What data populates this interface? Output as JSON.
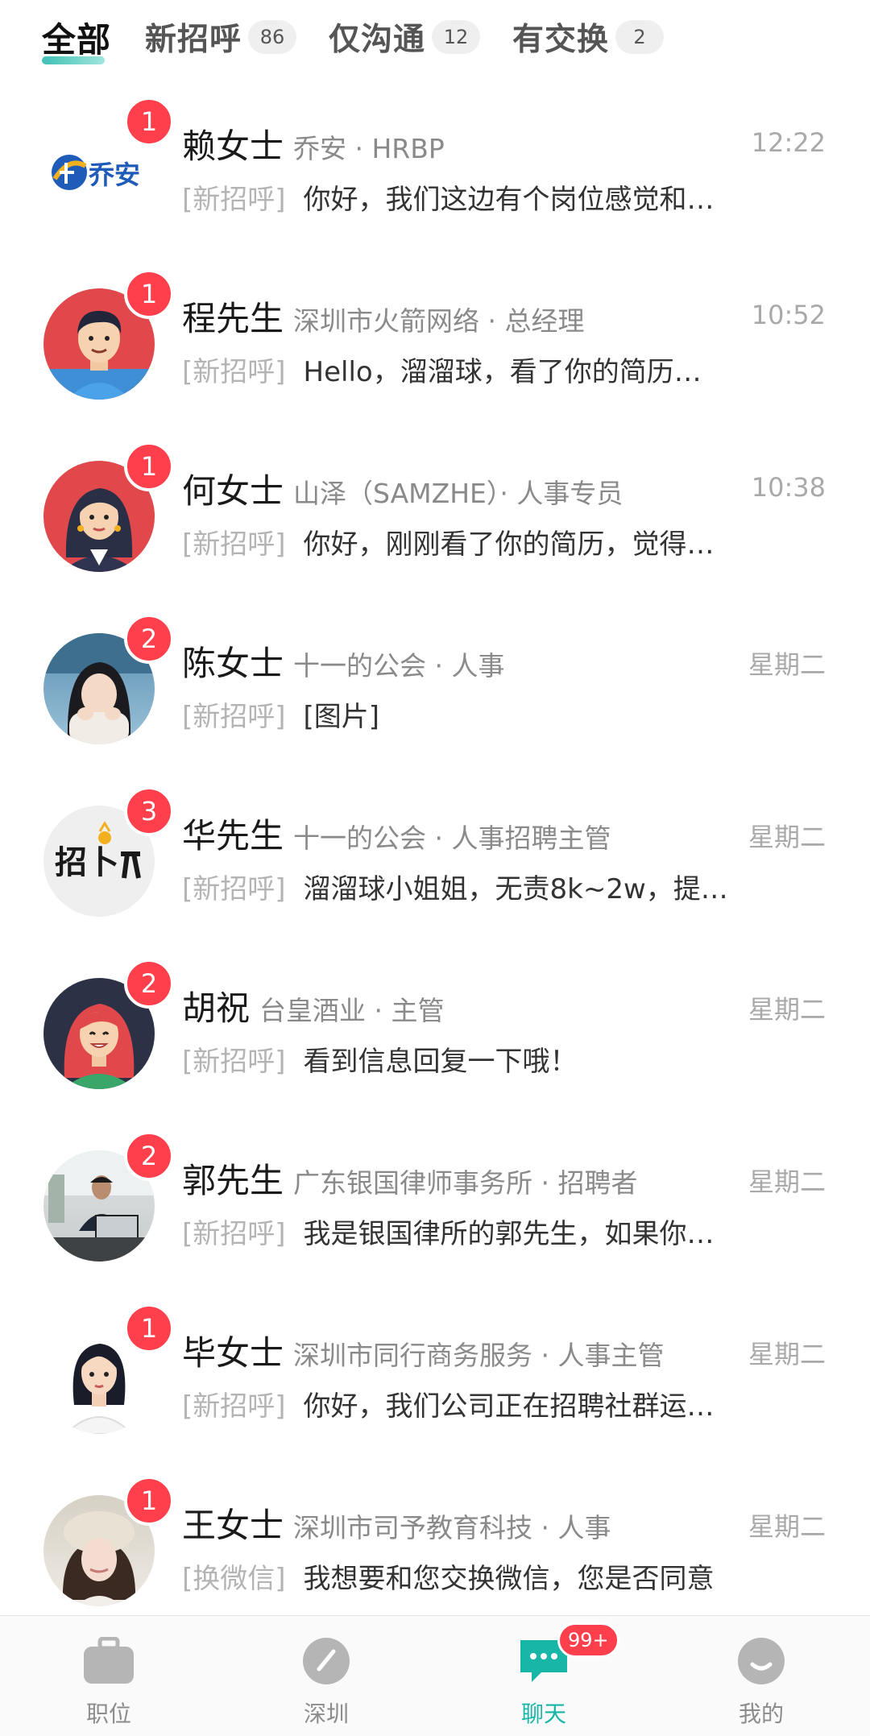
{
  "tabs": [
    {
      "label": "全部",
      "count": ""
    },
    {
      "label": "新招呼",
      "count": "86"
    },
    {
      "label": "仅沟通",
      "count": "12"
    },
    {
      "label": "有交换",
      "count": "2"
    }
  ],
  "chats": [
    {
      "name": "赖女士",
      "company": "乔安 · HRBP",
      "time": "12:22",
      "tag": "[新招呼]",
      "message": "你好，我们这边有个岗位感觉和…",
      "unread": "1",
      "avatar_icon": "qiaoan-logo",
      "avatar_text": "乔安"
    },
    {
      "name": "程先生",
      "company": "深圳市火箭网络 · 总经理",
      "time": "10:52",
      "tag": "[新招呼]",
      "message": "Hello，溜溜球，看了你的简历…",
      "unread": "1",
      "avatar_icon": "male-cartoon-avatar"
    },
    {
      "name": "何女士",
      "company": "山泽（SAMZHE）· 人事专员",
      "time": "10:38",
      "tag": "[新招呼]",
      "message": "你好，刚刚看了你的简历，觉得…",
      "unread": "1",
      "avatar_icon": "female-cartoon-avatar"
    },
    {
      "name": "陈女士",
      "company": "十一的公会 · 人事",
      "time": "星期二",
      "tag": "[新招呼]",
      "message": "[图片]",
      "unread": "2",
      "avatar_icon": "photo-avatar"
    },
    {
      "name": "华先生",
      "company": "十一的公会 · 人事招聘主管",
      "time": "星期二",
      "tag": "[新招呼]",
      "message": "溜溜球小姐姐，无责8k~2w，提…",
      "unread": "3",
      "avatar_icon": "zhaobobo-logo",
      "avatar_text": "招卜"
    },
    {
      "name": "胡祝",
      "company": "台皇酒业 · 主管",
      "time": "星期二",
      "tag": "[新招呼]",
      "message": "看到信息回复一下哦！",
      "unread": "2",
      "avatar_icon": "female-redhair-avatar"
    },
    {
      "name": "郭先生",
      "company": "广东银国律师事务所 · 招聘者",
      "time": "星期二",
      "tag": "[新招呼]",
      "message": "我是银国律所的郭先生，如果你…",
      "unread": "2",
      "avatar_icon": "office-photo-avatar"
    },
    {
      "name": "毕女士",
      "company": "深圳市同行商务服务 · 人事主管",
      "time": "星期二",
      "tag": "[新招呼]",
      "message": "你好，我们公司正在招聘社群运…",
      "unread": "1",
      "avatar_icon": "female-illustration-avatar"
    },
    {
      "name": "王女士",
      "company": "深圳市司予教育科技 · 人事",
      "time": "星期二",
      "tag": "[换微信]",
      "message": "我想要和您交换微信，您是否同意",
      "unread": "1",
      "avatar_icon": "hat-photo-avatar"
    }
  ],
  "nav": [
    {
      "label": "职位",
      "icon": "briefcase-icon"
    },
    {
      "label": "深圳",
      "icon": "compass-icon"
    },
    {
      "label": "聊天",
      "icon": "chat-icon",
      "badge": "99+"
    },
    {
      "label": "我的",
      "icon": "smile-icon"
    }
  ],
  "colors": {
    "accent": "#18b6a7",
    "badge": "#ff3f4c"
  }
}
